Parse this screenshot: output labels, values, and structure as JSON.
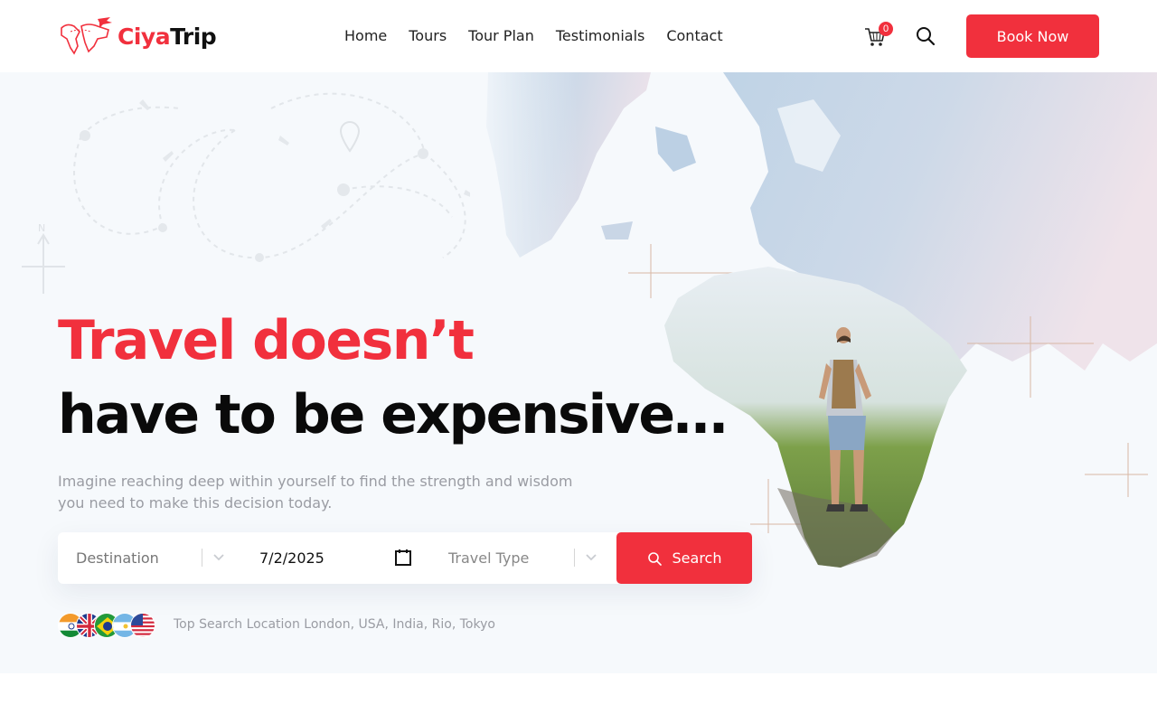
{
  "brand": {
    "name_part1": "Ciya",
    "name_part2": "Trip",
    "primary_color": "#f1303d"
  },
  "nav": {
    "items": [
      "Home",
      "Tours",
      "Tour Plan",
      "Testimonials",
      "Contact"
    ]
  },
  "header": {
    "cart_count": "0",
    "book_label": "Book Now"
  },
  "hero": {
    "title_red": "Travel doesn’t",
    "title_black": "have to be expensive…",
    "subtitle": "Imagine reaching deep within yourself to find the strength and wisdom you need to make this decision today."
  },
  "search": {
    "destination_placeholder": "Destination",
    "date_value": "7/2/2025",
    "travel_type_placeholder": "Travel Type",
    "button_label": "Search"
  },
  "top_search": {
    "text": "Top Search Location London, USA, India, Rio, Tokyo",
    "flags": [
      "india-flag-icon",
      "uk-flag-icon",
      "brazil-flag-icon",
      "argentina-flag-icon",
      "usa-flag-icon"
    ]
  }
}
